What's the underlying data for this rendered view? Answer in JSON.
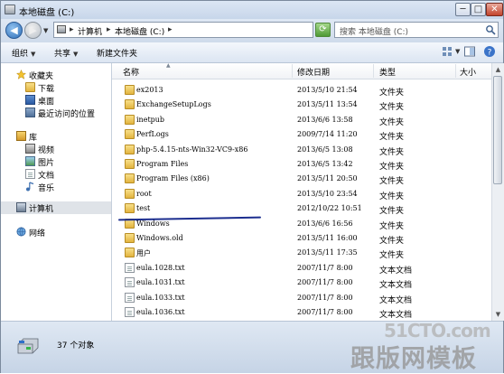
{
  "window": {
    "title": "本地磁盘 (C:)",
    "min_glyph": "─",
    "max_glyph": "□",
    "close_glyph": "✕"
  },
  "nav": {
    "back_glyph": "◀",
    "forward_glyph": "▶",
    "drop_glyph": "▼"
  },
  "address": {
    "arrow": "▸",
    "crumbs": [
      "计算机",
      "本地磁盘 (C:)"
    ],
    "drop_glyph": "▼",
    "refresh_glyph": "⟳"
  },
  "search": {
    "placeholder": "搜索 本地磁盘 (C:)"
  },
  "toolbar": {
    "organize": "组织",
    "share": "共享",
    "new_folder": "新建文件夹",
    "drop_glyph": "▼"
  },
  "sidebar": {
    "favorites": "收藏夹",
    "downloads": "下载",
    "desktop": "桌面",
    "recent": "最近访问的位置",
    "libraries": "库",
    "videos": "视频",
    "pictures": "图片",
    "documents": "文档",
    "music": "音乐",
    "computer": "计算机",
    "network": "网络"
  },
  "columns": {
    "name": "名称",
    "modified": "修改日期",
    "type": "类型",
    "size": "大小",
    "sort_glyph": "▲"
  },
  "files": [
    {
      "name": "ex2013",
      "date": "2013/5/10 21:54",
      "type": "文件夹",
      "icon": "folder-icon"
    },
    {
      "name": "ExchangeSetupLogs",
      "date": "2013/5/11 13:54",
      "type": "文件夹",
      "icon": "folder-icon"
    },
    {
      "name": "inetpub",
      "date": "2013/6/6 13:58",
      "type": "文件夹",
      "icon": "folder-icon"
    },
    {
      "name": "PerfLogs",
      "date": "2009/7/14 11:20",
      "type": "文件夹",
      "icon": "folder-icon"
    },
    {
      "name": "php-5.4.15-nts-Win32-VC9-x86",
      "date": "2013/6/5 13:08",
      "type": "文件夹",
      "icon": "folder-icon"
    },
    {
      "name": "Program Files",
      "date": "2013/6/5 13:42",
      "type": "文件夹",
      "icon": "folder-icon"
    },
    {
      "name": "Program Files (x86)",
      "date": "2013/5/11 20:50",
      "type": "文件夹",
      "icon": "folder-icon"
    },
    {
      "name": "root",
      "date": "2013/5/10 23:54",
      "type": "文件夹",
      "icon": "folder-icon"
    },
    {
      "name": "test",
      "date": "2012/10/22 10:51",
      "type": "文件夹",
      "icon": "folder-icon"
    },
    {
      "name": "Windows",
      "date": "2013/6/6 16:56",
      "type": "文件夹",
      "icon": "folder-icon"
    },
    {
      "name": "Windows.old",
      "date": "2013/5/11 16:00",
      "type": "文件夹",
      "icon": "folder-icon"
    },
    {
      "name": "用户",
      "date": "2013/5/11 17:35",
      "type": "文件夹",
      "icon": "folder-icon"
    },
    {
      "name": "eula.1028.txt",
      "date": "2007/11/7 8:00",
      "type": "文本文档",
      "icon": "text-file-icon"
    },
    {
      "name": "eula.1031.txt",
      "date": "2007/11/7 8:00",
      "type": "文本文档",
      "icon": "text-file-icon"
    },
    {
      "name": "eula.1033.txt",
      "date": "2007/11/7 8:00",
      "type": "文本文档",
      "icon": "text-file-icon"
    },
    {
      "name": "eula.1036.txt",
      "date": "2007/11/7 8:00",
      "type": "文本文档",
      "icon": "text-file-icon"
    }
  ],
  "status": {
    "count": "37 个对象"
  },
  "watermark": {
    "line1": "51CTO.com",
    "line2": "跟版网模板"
  },
  "colors": {
    "underline": "#1c2e8f",
    "folder": "#e2b43f"
  }
}
